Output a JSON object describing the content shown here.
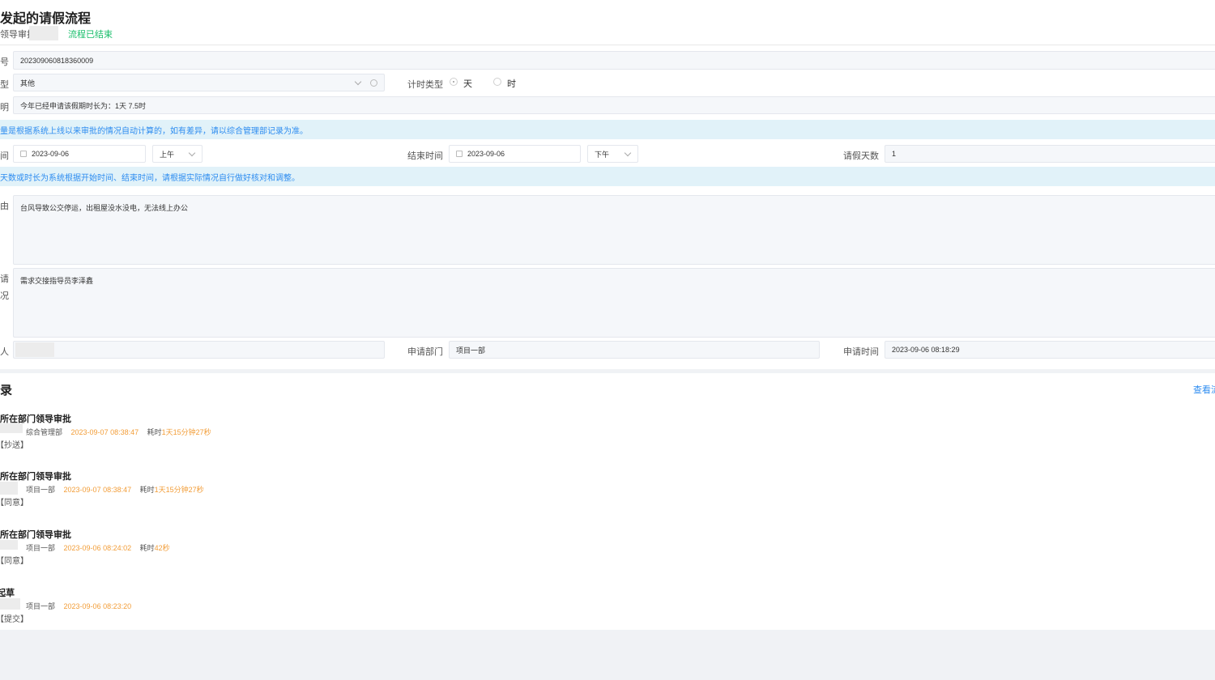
{
  "header": {
    "title": "发起的请假流程",
    "current_step": "领导审批",
    "status": "流程已结束"
  },
  "form": {
    "serial": {
      "label": "号",
      "value": "202309060818360009"
    },
    "leave_type": {
      "label": "型",
      "value": "其他"
    },
    "timing_type": {
      "label": "计时类型",
      "options": [
        "天",
        "时"
      ],
      "selected": "天"
    },
    "note": {
      "label": "明",
      "value": "今年已经申请该假期时长为：1天  7.5时"
    },
    "notice1": "量是根据系统上线以来审批的情况自动计算的，如有差异，请以综合管理部记录为准。",
    "start": {
      "label": "间",
      "date": "2023-09-06",
      "period": "上午"
    },
    "end": {
      "label": "结束时间",
      "date": "2023-09-06",
      "period": "下午"
    },
    "days": {
      "label": "请假天数",
      "value": "1"
    },
    "notice2": "天数或时长为系统根据开始时间、结束时间，请根据实际情况自行做好核对和调整。",
    "reason": {
      "label": "由",
      "value": "台风导致公交停运，出租屋没水没电，无法线上办公"
    },
    "handover": {
      "label1": "请",
      "label2": "况",
      "value": "需求交接指导员李泽鑫"
    },
    "applicant": {
      "label": "人"
    },
    "department": {
      "label": "申请部门",
      "value": "项目一部"
    },
    "apply_time": {
      "label": "申请时间",
      "value": "2023-09-06 08:18:29"
    }
  },
  "records": {
    "title": "录",
    "view_link": "查看流",
    "items": [
      {
        "step": "所在部门领导审批",
        "dept": "综合管理部",
        "time": "2023-09-07 08:38:47",
        "elapsed_label": "耗时",
        "elapsed": "1天15分钟27秒",
        "result": "【抄送】"
      },
      {
        "step": "所在部门领导审批",
        "dept": "项目一部",
        "time": "2023-09-07 08:38:47",
        "elapsed_label": "耗时",
        "elapsed": "1天15分钟27秒",
        "result": "【同意】"
      },
      {
        "step": "所在部门领导审批",
        "dept": "项目一部",
        "time": "2023-09-06 08:24:02",
        "elapsed_label": "耗时",
        "elapsed": "42秒",
        "result": "【同意】"
      },
      {
        "step": "起草",
        "dept": "项目一部",
        "time": "2023-09-06 08:23:20",
        "elapsed_label": "",
        "elapsed": "",
        "result": "【提交】"
      }
    ]
  }
}
